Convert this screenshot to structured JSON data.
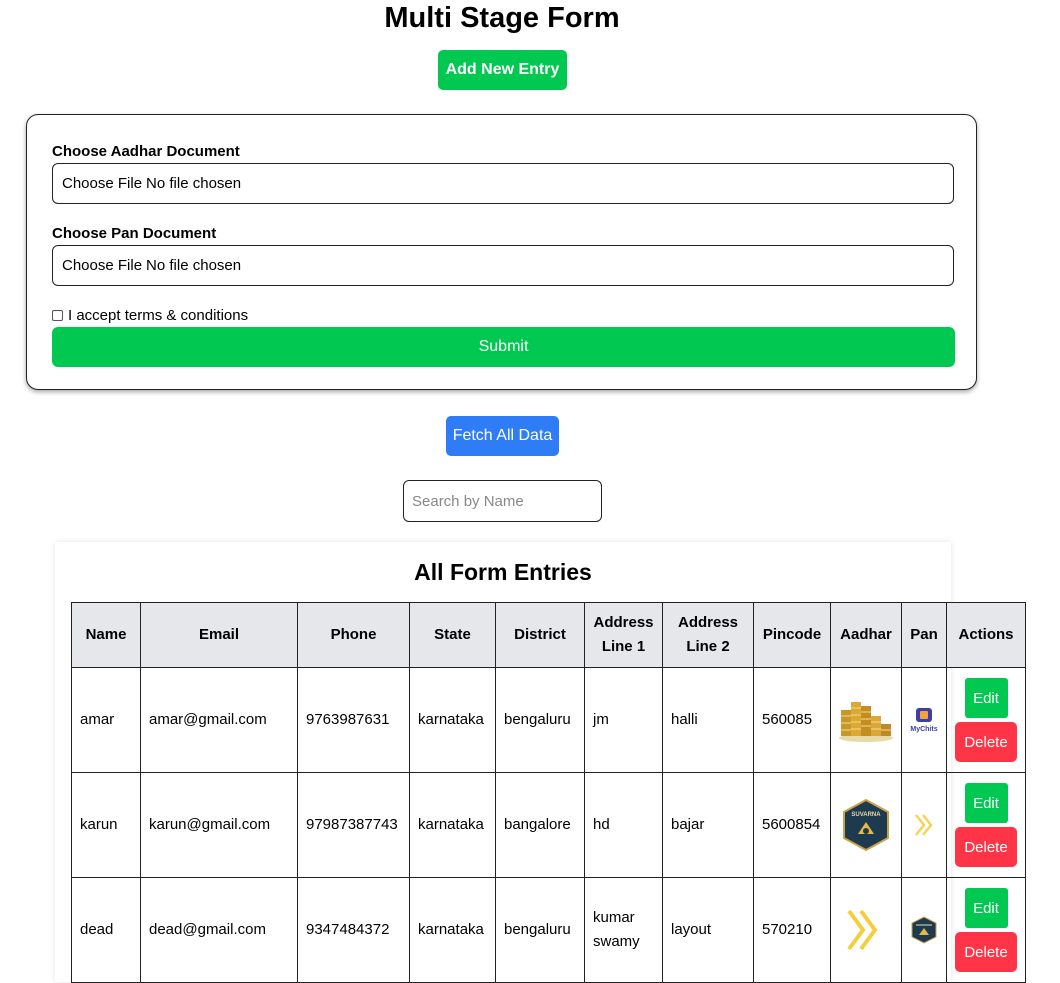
{
  "header": {
    "title": "Multi Stage Form",
    "add_button": "Add New Entry"
  },
  "form": {
    "aadhar_label": "Choose Aadhar Document",
    "aadhar_choose": "Choose File",
    "aadhar_status": "No file chosen",
    "pan_label": "Choose Pan Document",
    "pan_choose": "Choose File",
    "pan_status": "No file chosen",
    "terms_label": "I accept terms & conditions",
    "terms_checked": false,
    "submit_label": "Submit"
  },
  "fetch_button": "Fetch All Data",
  "search": {
    "placeholder": "Search by Name",
    "value": ""
  },
  "entries": {
    "title": "All Form Entries",
    "columns": {
      "name": "Name",
      "email": "Email",
      "phone": "Phone",
      "state": "State",
      "district": "District",
      "address1": "Address Line 1",
      "address2": "Address Line 2",
      "pincode": "Pincode",
      "aadhar": "Aadhar",
      "pan": "Pan",
      "actions": "Actions"
    },
    "rows": [
      {
        "name": "amar",
        "email": "amar@gmail.com",
        "phone": "9763987631",
        "state": "karnataka",
        "district": "bengaluru",
        "address1": "jm",
        "address2": "halli",
        "pincode": "560085",
        "aadhar_image": "gold-coins-image",
        "pan_image": "mychits-logo-image",
        "pan_logo_text": "MyChits",
        "edit_label": "Edit",
        "delete_label": "Delete"
      },
      {
        "name": "karun",
        "email": "karun@gmail.com",
        "phone": "97987387743",
        "state": "karnataka",
        "district": "bangalore",
        "address1": "hd",
        "address2": "bajar",
        "pincode": "5600854",
        "aadhar_image": "suvarna-badge-logo-image",
        "pan_image": "yellow-chevrons-image",
        "aadhar_logo_text": "SUVARNA",
        "edit_label": "Edit",
        "delete_label": "Delete"
      },
      {
        "name": "dead",
        "email": "dead@gmail.com",
        "phone": "9347484372",
        "state": "karnataka",
        "district": "bengaluru",
        "address1": "kumar swamy",
        "address2": "layout",
        "pincode": "570210",
        "aadhar_image": "yellow-chevrons-image",
        "pan_image": "suvarna-badge-logo-image",
        "edit_label": "Edit",
        "delete_label": "Delete"
      }
    ]
  },
  "colors": {
    "green": "#00c851",
    "blue": "#2e7df6",
    "red": "#ff3547",
    "header_bg": "#e5e7eb"
  }
}
